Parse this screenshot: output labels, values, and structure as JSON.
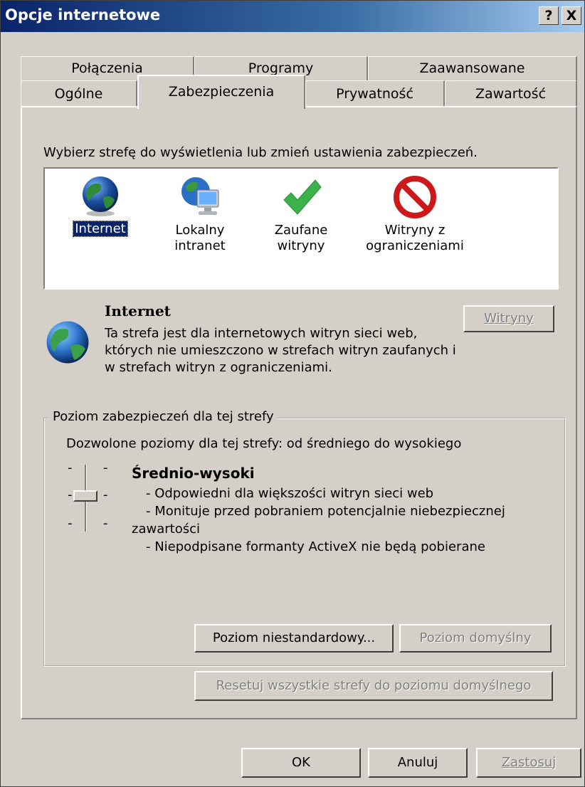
{
  "window": {
    "title": "Opcje internetowe",
    "help_button": "?",
    "close_button": "X"
  },
  "tabs": {
    "row_back": [
      {
        "label": "Połączenia"
      },
      {
        "label": "Programy"
      },
      {
        "label": "Zaawansowane"
      }
    ],
    "row_front": [
      {
        "label": "Ogólne"
      },
      {
        "label": "Zabezpieczenia",
        "active": true
      },
      {
        "label": "Prywatność"
      },
      {
        "label": "Zawartość"
      }
    ]
  },
  "zone_section": {
    "instruction": "Wybierz strefę do wyświetlenia lub zmień ustawienia zabezpieczeń.",
    "zones": [
      {
        "label": "Internet",
        "icon": "globe-icon",
        "selected": true
      },
      {
        "label": "Lokalny intranet",
        "icon": "intranet-icon"
      },
      {
        "label": "Zaufane witryny",
        "icon": "checkmark-icon"
      },
      {
        "label": "Witryny z ograniczeniami",
        "icon": "restricted-icon"
      }
    ]
  },
  "zone_info": {
    "title": "Internet",
    "description": "Ta strefa jest dla internetowych witryn sieci web, których nie umieszczono w strefach witryn zaufanych i w strefach witryn z ograniczeniami.",
    "sites_button": "Witryny"
  },
  "security_level": {
    "group_title": "Poziom zabezpieczeń dla tej strefy",
    "allowed_levels": "Dozwolone poziomy dla tej strefy: od średniego do wysokiego",
    "level_name": "Średnio-wysoki",
    "bullets": [
      "- Odpowiedni dla większości witryn sieci web",
      "- Monituje przed pobraniem potencjalnie niebezpiecznej zawartości",
      "- Niepodpisane formanty ActiveX nie będą pobierane"
    ],
    "custom_level_button": "Poziom niestandardowy...",
    "default_level_button": "Poziom domyślny"
  },
  "reset_button": "Resetuj wszystkie strefy do poziomu domyślnego",
  "footer": {
    "ok": "OK",
    "cancel": "Anuluj",
    "apply": "Zastosuj"
  },
  "colors": {
    "title_gradient_start": "#0a246a",
    "title_gradient_end": "#a6caf0",
    "face": "#d4d0c8",
    "selection": "#0a246a"
  }
}
